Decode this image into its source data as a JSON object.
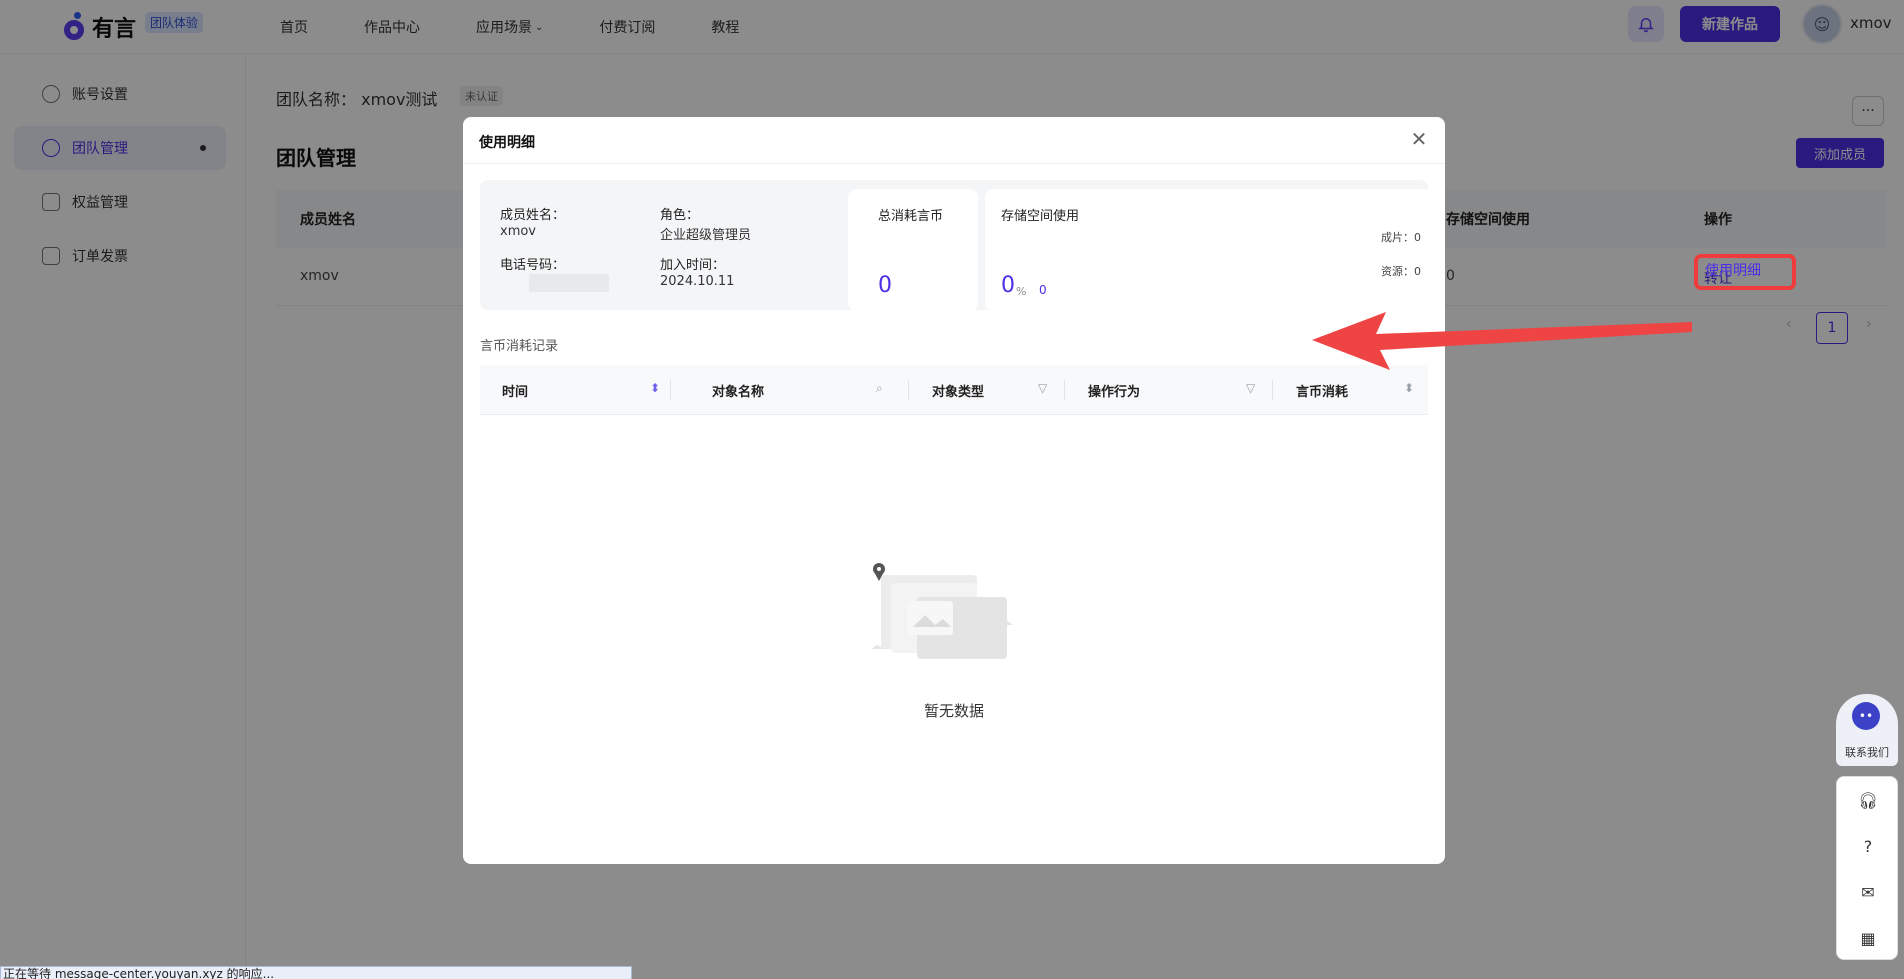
{
  "header": {
    "logo_text": "有言",
    "team_badge": "团队体验",
    "nav": [
      "首页",
      "作品中心",
      "应用场景",
      "付费订阅",
      "教程"
    ],
    "new_button": "新建作品",
    "username": "xmov"
  },
  "sidebar": {
    "items": [
      {
        "label": "账号设置",
        "icon": "user-icon"
      },
      {
        "label": "团队管理",
        "icon": "team-icon"
      },
      {
        "label": "权益管理",
        "icon": "rights-icon"
      },
      {
        "label": "订单发票",
        "icon": "invoice-icon"
      }
    ]
  },
  "main": {
    "team_name_label": "团队名称：",
    "team_name": "xmov测试",
    "unauth_badge": "未认证",
    "page_title": "团队管理",
    "add_member": "添加成员",
    "columns": [
      "成员姓名",
      "存储空间使用",
      "操作"
    ],
    "row": {
      "name": "xmov",
      "storage": "0",
      "transfer": "转让",
      "usage": "使用明细"
    },
    "page": "1"
  },
  "modal": {
    "title": "使用明细",
    "info": {
      "name_label": "成员姓名：",
      "name": "xmov",
      "role_label": "角色：",
      "role": "企业超级管理员",
      "phone_label": "电话号码：",
      "join_label": "加入时间：",
      "join_date": "2024.10.11"
    },
    "coin_card": {
      "title": "总消耗言币",
      "value": "0"
    },
    "storage_card": {
      "title": "存储空间使用",
      "percent": "0",
      "unit": "%",
      "used": "0",
      "finished_label": "成片：0",
      "resource_label": "资源：0"
    },
    "section_label": "言币消耗记录",
    "table_columns": [
      "时间",
      "对象名称",
      "对象类型",
      "操作行为",
      "言币消耗"
    ],
    "empty_text": "暂无数据"
  },
  "float": {
    "contact": "联系我们"
  },
  "status_bar": "正在等待 message-center.youyan.xyz 的响应..."
}
